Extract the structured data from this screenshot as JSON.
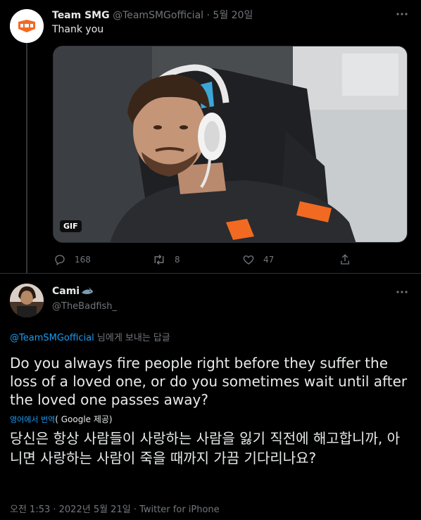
{
  "tweet1": {
    "name": "Team SMG",
    "handle": "@TeamSMGofficial",
    "separator": "·",
    "date": "5월 20일",
    "text": "Thank you",
    "gif_badge": "GIF",
    "reply_count": "168",
    "retweet_count": "8",
    "like_count": "47",
    "icons": [
      "team-smg-logo",
      "more-icon",
      "reply-icon",
      "retweet-icon",
      "like-icon",
      "share-icon"
    ]
  },
  "tweet2": {
    "name": "Cami",
    "handle": "@TheBadfish_",
    "reply_to_handle": "@TeamSMGofficial",
    "reply_to_suffix": "님에게 보내는 답글",
    "body": "Do you always fire people right before they suffer the loss of a loved one, or do you sometimes wait until after the loved one passes away?",
    "translate_label": "영어에서 번역",
    "translate_source": "( Google 제공)",
    "translated_body": "당신은 항상 사람들이 사랑하는 사람을 잃기 직전에 해고합니까, 아니면 사랑하는 사람이 죽을 때까지 가끔 기다리나요?",
    "timestamp": "오전 1:53 · 2022년 5월 21일 · Twitter for iPhone",
    "icons": [
      "shark-emoji",
      "more-icon"
    ]
  },
  "colors": {
    "background": "#000000",
    "text": "#e7e9ea",
    "muted": "#71767b",
    "link": "#1d9bf0",
    "brand": "#f26a21"
  }
}
